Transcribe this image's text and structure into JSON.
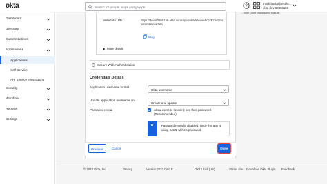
{
  "header": {
    "logo": "okta",
    "search_placeholder": "Search for people, apps and groups",
    "user_email": "mitch.busla@test.lo...",
    "user_org": "okta-dev-60868159"
  },
  "sidebar": {
    "items": [
      {
        "label": "Dashboard"
      },
      {
        "label": "Directory"
      },
      {
        "label": "Customizations"
      },
      {
        "label": "Applications"
      },
      {
        "label": "Security"
      },
      {
        "label": "Workflow"
      },
      {
        "label": "Reports"
      },
      {
        "label": "Settings"
      }
    ],
    "sub_items": [
      {
        "label": "Applications",
        "active": true
      },
      {
        "label": "Self Service",
        "active": false
      },
      {
        "label": "API Service Integrations",
        "active": false
      }
    ]
  },
  "right_snippet": "...form_post processing feature.",
  "metadata": {
    "label": "Metadata URL",
    "url": "https://dev-60868159.okta.com/app/exk9ib6exwi4lozzFz5d7/sso/saml/metadata",
    "copy_label": "Copy",
    "more_details": "More details"
  },
  "swa": {
    "label": "Secure Web Authentication"
  },
  "credentials": {
    "title": "Credentials Details",
    "username_format_label": "Application username format",
    "username_format_value": "Okta username",
    "update_on_label": "Update application username on",
    "update_on_value": "Create and update",
    "password_reveal_label": "Password reveal",
    "password_reveal_checkbox": "Allow users to securely see their password (Recommended)",
    "info_text": "Password reveal is disabled, since this app is using SAML with no password."
  },
  "buttons": {
    "previous": "Previous",
    "cancel": "Cancel",
    "done": "Done"
  },
  "footer": {
    "copyright": "© 2023 Okta, Inc.",
    "privacy": "Privacy",
    "version": "Version 2023.04.0 E",
    "cell": "OK12 Cell (US)",
    "status": "Status site",
    "download_plugin": "Download Okta Plugin",
    "feedback": "Feedback"
  },
  "colors": {
    "accent": "#1662dd",
    "focus_ring": "#e8433b"
  }
}
